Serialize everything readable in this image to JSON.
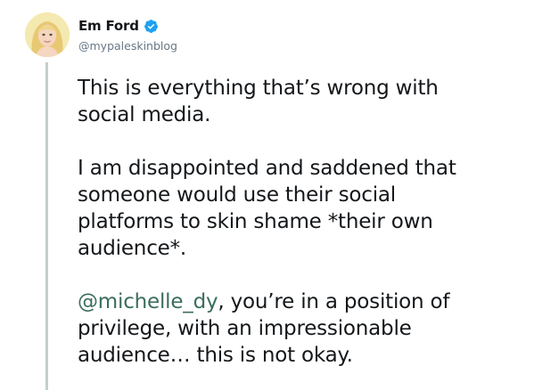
{
  "author": {
    "display_name": "Em Ford",
    "handle": "@mypaleskinblog",
    "verified": true,
    "verified_color": "#1da1f2",
    "avatar_icon": "profile-photo"
  },
  "tweet": {
    "paragraph1": [
      "This is everything that’s wrong with",
      "social media."
    ],
    "paragraph2": [
      "I am disappointed and saddened that",
      "someone would use their social",
      "platforms to skin shame *their own",
      "audience*."
    ],
    "paragraph3": {
      "mention": "@michelle_dy",
      "line1_rest": ", you’re in a position of",
      "line2": "privilege, with an impressionable",
      "line3": "audience… this is not okay."
    }
  },
  "colors": {
    "text": "#14171a",
    "secondary_text": "#657786",
    "mention": "#3b6e5b",
    "thread_line": "#c3cfcc"
  }
}
